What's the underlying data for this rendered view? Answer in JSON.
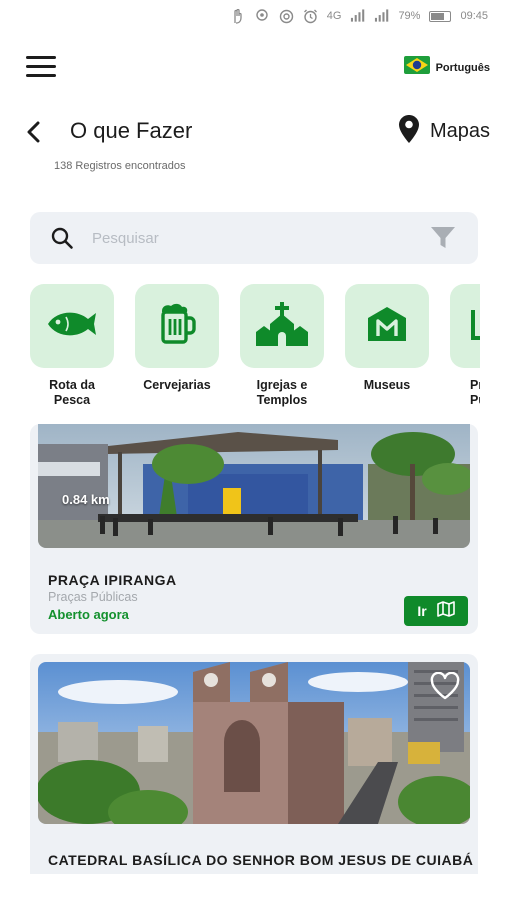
{
  "status_bar": {
    "battery": "79%",
    "time": "09:45",
    "network": "4G",
    "battery_level": 0.79
  },
  "header": {
    "language_label": "Português"
  },
  "title_bar": {
    "title": "O que Fazer",
    "maps_label": "Mapas"
  },
  "results_count": "138  Registros encontrados",
  "search": {
    "placeholder": "Pesquisar"
  },
  "categories": [
    {
      "label": "Rota da\nPesca",
      "icon": "fish-icon"
    },
    {
      "label": "Cervejarias",
      "icon": "beer-mug-icon"
    },
    {
      "label": "Igrejas e\nTemplos",
      "icon": "church-icon"
    },
    {
      "label": "Museus",
      "icon": "museum-icon"
    },
    {
      "label": "Pr\nPú",
      "icon": "park-icon"
    }
  ],
  "places": [
    {
      "distance": "0.84 km",
      "name": "PRAÇA IPIRANGA",
      "category": "Praças Públicas",
      "status": "Aberto agora",
      "go_label": "Ir"
    },
    {
      "name": "CATEDRAL BASÍLICA DO SENHOR BOM JESUS DE CUIABÁ"
    }
  ],
  "colors": {
    "accent": "#0f8a2a",
    "tile_bg": "#d9f1dd",
    "open_status": "#14912e"
  }
}
